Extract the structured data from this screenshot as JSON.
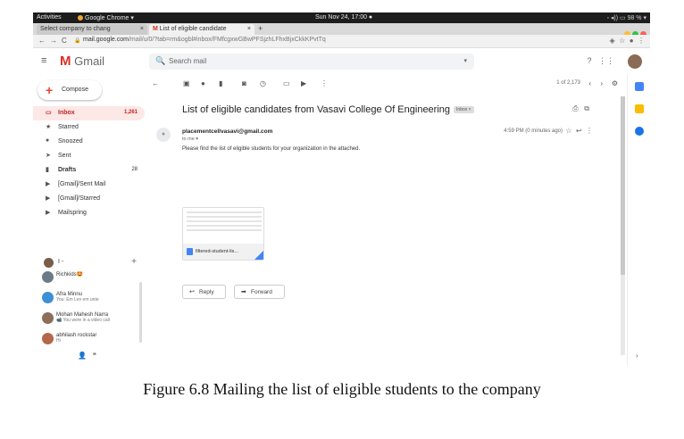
{
  "topbar": {
    "activities": "Activities",
    "app": "Google Chrome ▾",
    "clock": "Sun Nov 24, 17:00 ●",
    "system": "◦ ◂)) ▭ 98 % ▾"
  },
  "browser": {
    "tabs": [
      {
        "label": "Select company to chang",
        "close": "×"
      },
      {
        "label": "List of eligible candidate",
        "close": "×"
      }
    ],
    "new_tab": "+",
    "url_host": "mail.google.com",
    "url_path": "/mail/u/0/?tab=rm&ogbl#inbox/FMfcgxwGBwPFSjzhLFhxBjxCkkKPvtTq",
    "colors": {
      "red": "#ff5f57",
      "yellow": "#febc2e",
      "green": "#28c840"
    }
  },
  "gmail": {
    "logo_text": "Gmail",
    "search_placeholder": "Search mail",
    "compose": "Compose",
    "nav": [
      {
        "icon": "inbox-icon",
        "label": "Inbox",
        "count": "1,261"
      },
      {
        "icon": "star-icon",
        "label": "Starred",
        "count": ""
      },
      {
        "icon": "clock-icon",
        "label": "Snoozed",
        "count": ""
      },
      {
        "icon": "send-icon",
        "label": "Sent",
        "count": ""
      },
      {
        "icon": "draft-icon",
        "label": "Drafts",
        "count": "28"
      },
      {
        "icon": "label-icon",
        "label": "[Gmail]/Sent Mail",
        "count": ""
      },
      {
        "icon": "label-icon",
        "label": "[Gmail]/Starred",
        "count": ""
      },
      {
        "icon": "label-icon",
        "label": "Mailspring",
        "count": ""
      }
    ],
    "hangouts_me": "I -",
    "contacts": [
      {
        "name": "Richkids🤩",
        "sub": ""
      },
      {
        "name": "Afra Minnu",
        "sub": "You: Em Lev em unte"
      },
      {
        "name": "Mohan Mahesh Narra",
        "sub": "📹 You were in a video call"
      },
      {
        "name": "abhilash rockstar",
        "sub": "Hi"
      }
    ],
    "pager": "1 of 2,173",
    "subject": "List of eligible candidates from Vasavi College Of Engineering",
    "chip": "Inbox ×",
    "sender": "placementcellvasavi@gmail.com",
    "to_me": "to me ▾",
    "time": "4:59 PM (0 minutes ago)",
    "body": "Please find the list of eligible students for your organization in the attached.",
    "attachment": "filtered-student-lis...",
    "reply": "Reply",
    "forward": "Forward"
  },
  "caption": "Figure 6.8 Mailing the list of eligible students to the company"
}
